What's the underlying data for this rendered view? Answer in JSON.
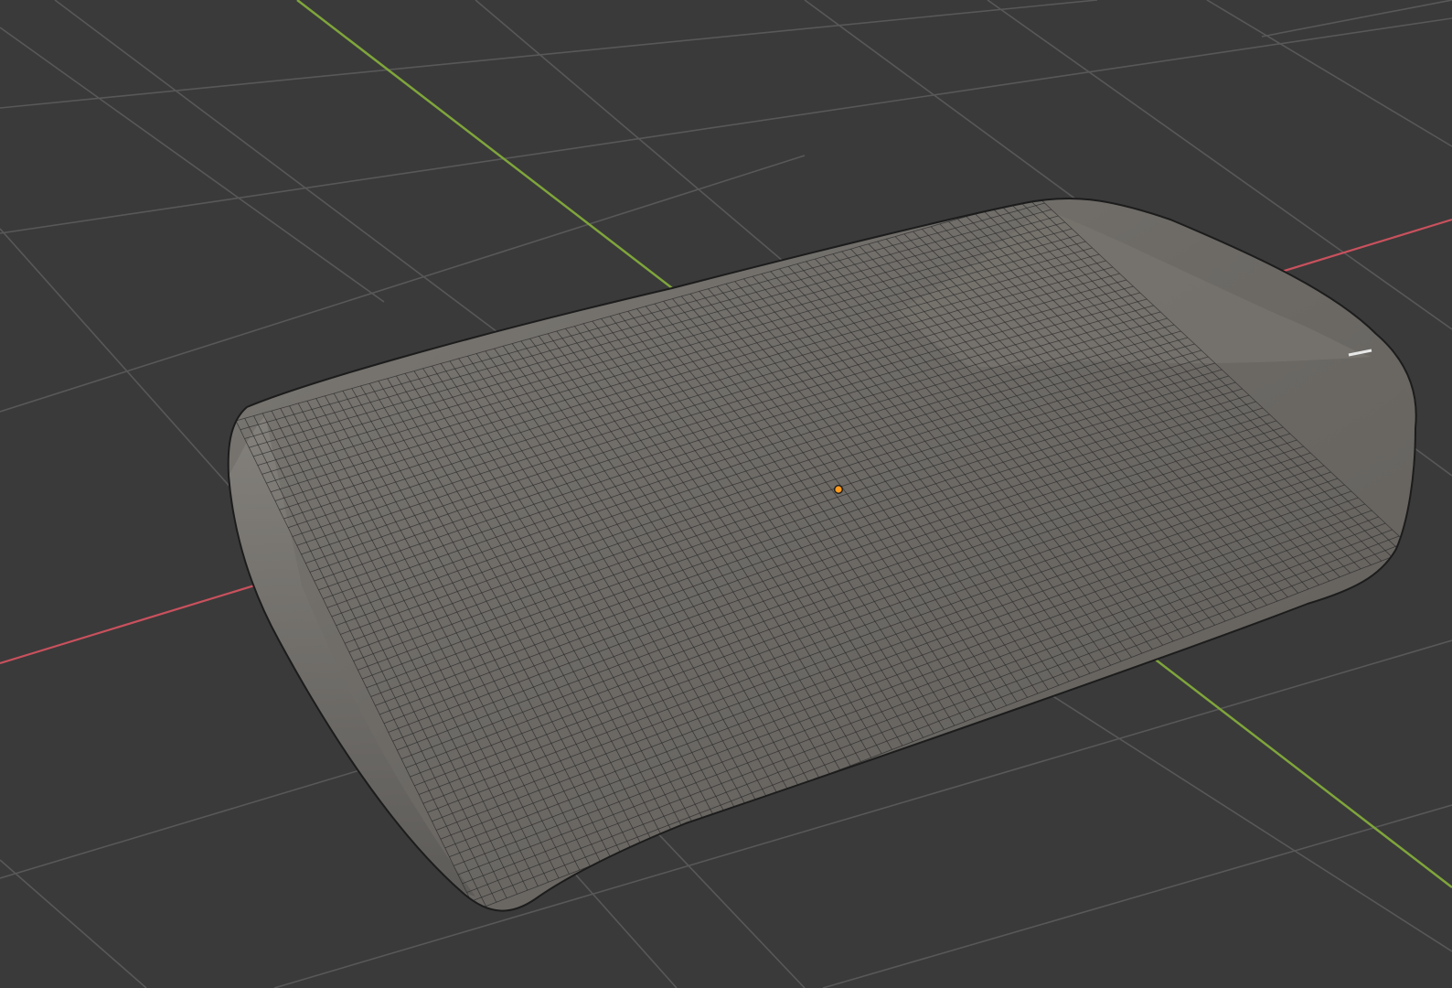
{
  "viewport": {
    "type": "3d-viewport",
    "background_color": "#3a3a3a",
    "grid_color": "#585858",
    "x_axis_color": "#c9515d",
    "y_axis_color": "#7fa53b",
    "mesh": {
      "shape": "rounded-box-sculpt",
      "face_color": "#6f6c68",
      "wire_color": "#2b2b2b",
      "outline_color": "#1b1b1b"
    },
    "origin_color": "#ff9a20"
  }
}
